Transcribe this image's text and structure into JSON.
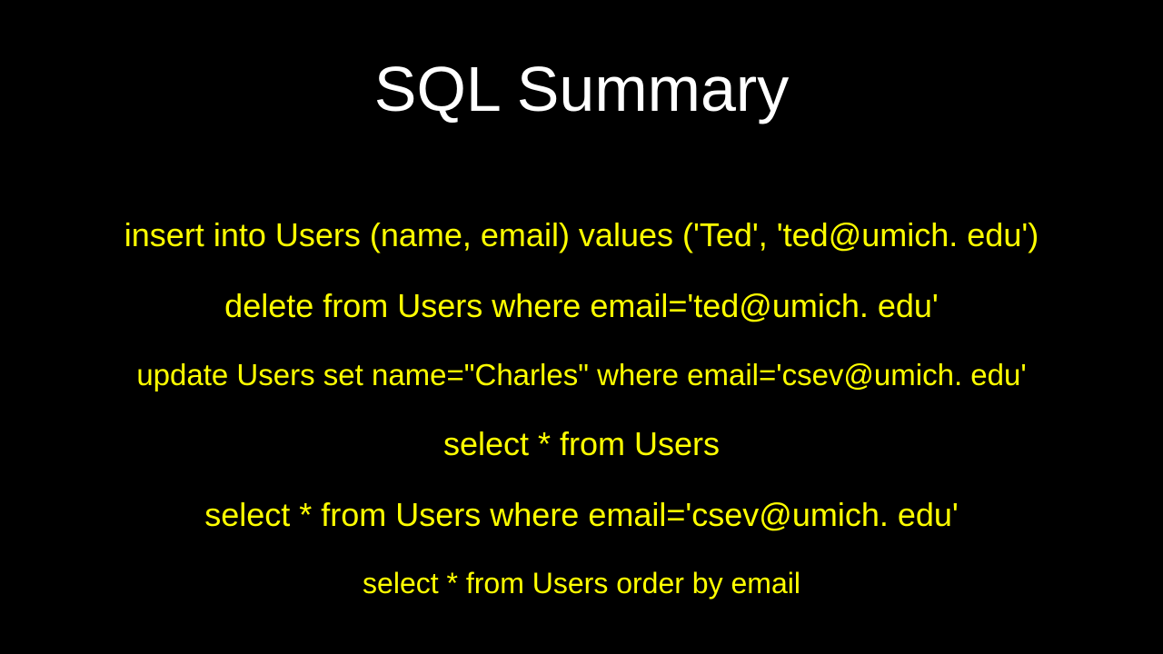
{
  "slide": {
    "title": "SQL Summary",
    "lines": [
      "insert into Users (name, email) values ('Ted', 'ted@umich. edu')",
      "delete from Users where email='ted@umich. edu'",
      "update Users set name=\"Charles\" where email='csev@umich. edu'",
      "select * from Users",
      "select * from Users where email='csev@umich. edu'",
      "select * from Users order by email"
    ]
  }
}
